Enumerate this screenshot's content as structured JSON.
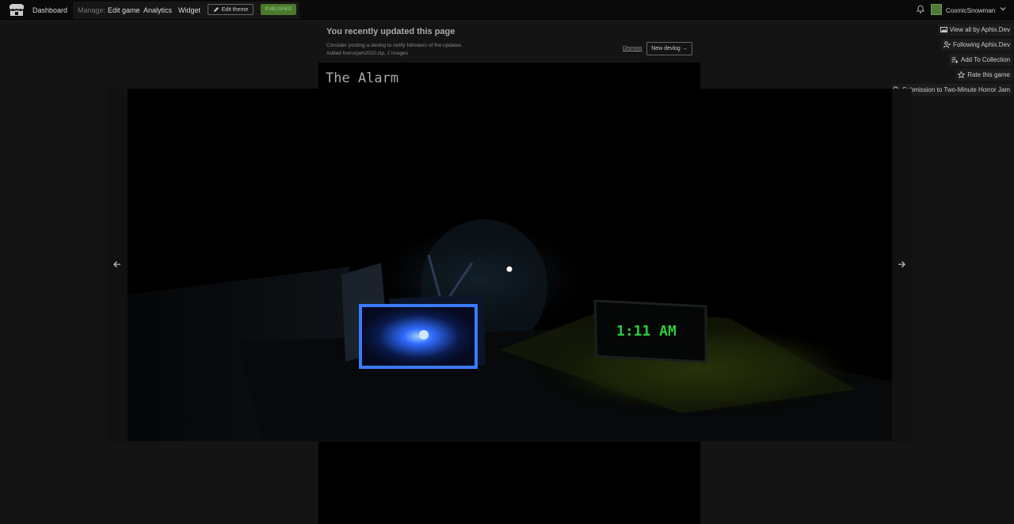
{
  "header": {
    "dashboard": "Dashboard",
    "manage": "Manage:",
    "edit_game": "Edit game",
    "analytics": "Analytics",
    "widget": "Widget",
    "edit_theme": "Edit theme",
    "published": "PUBLISHED",
    "username": "CosmicSnowman"
  },
  "notice": {
    "title": "You recently updated this page",
    "line1": "Consider posting a devlog to notify followers of the updates.",
    "line2": "Added horrorjam2020.zip, 2 images",
    "dismiss": "Dismiss",
    "new_devlog": "New devlog →"
  },
  "game": {
    "title": "The Alarm"
  },
  "side_buttons": {
    "view_all": "View all by Aphix.Dev",
    "following": "Following Aphix.Dev",
    "add_collection": "Add To Collection",
    "rate": "Rate this game",
    "submission": "Submission to Two-Minute Horror Jam"
  },
  "screenshot": {
    "clock_text": "1:11 AM"
  },
  "colors": {
    "published_bg": "#4a7a2a",
    "clock_green": "#2ecc40",
    "tv_blue": "#3a7bff"
  },
  "icons": {
    "logo": "itchio-logo-icon",
    "edit": "pencil-icon",
    "bell": "bell-icon",
    "chevron": "chevron-down-icon",
    "prev": "arrow-left-icon",
    "next": "arrow-right-icon"
  }
}
